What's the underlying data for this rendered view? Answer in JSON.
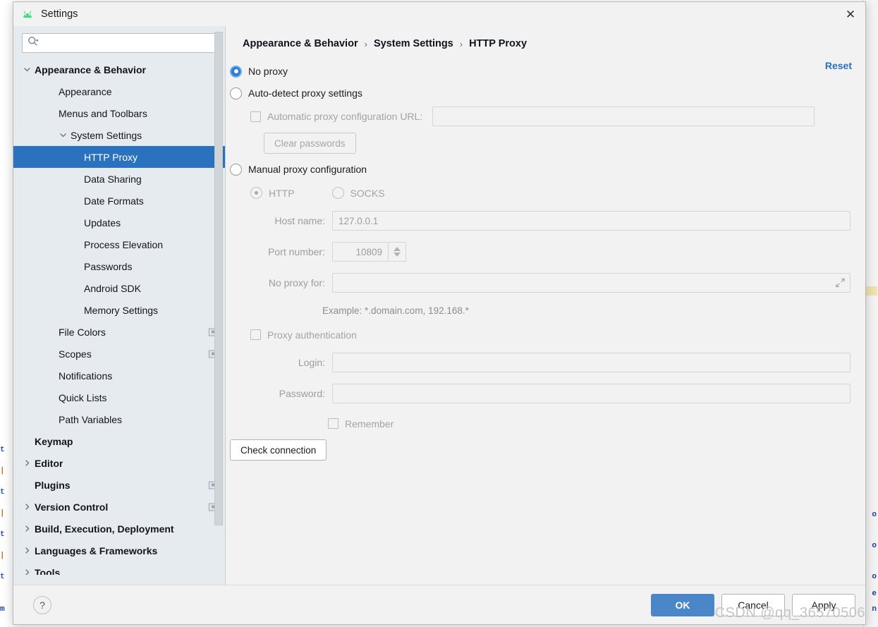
{
  "window": {
    "title": "Settings",
    "logo_icon": "android-logo-icon",
    "close_icon": "close-icon"
  },
  "sidebar": {
    "search": {
      "value": "",
      "placeholder": "",
      "icon": "search-icon"
    },
    "items": [
      {
        "label": "Appearance & Behavior",
        "level": 0,
        "bold": true,
        "arrow": "down",
        "selected": false,
        "badge": false
      },
      {
        "label": "Appearance",
        "level": 1,
        "bold": false,
        "arrow": "none",
        "selected": false,
        "badge": false
      },
      {
        "label": "Menus and Toolbars",
        "level": 1,
        "bold": false,
        "arrow": "none",
        "selected": false,
        "badge": false
      },
      {
        "label": "System Settings",
        "level": 2,
        "bold": false,
        "arrow": "down",
        "selected": false,
        "badge": false
      },
      {
        "label": "HTTP Proxy",
        "level": 3,
        "bold": false,
        "arrow": "none",
        "selected": true,
        "badge": false
      },
      {
        "label": "Data Sharing",
        "level": 3,
        "bold": false,
        "arrow": "none",
        "selected": false,
        "badge": false
      },
      {
        "label": "Date Formats",
        "level": 3,
        "bold": false,
        "arrow": "none",
        "selected": false,
        "badge": false
      },
      {
        "label": "Updates",
        "level": 3,
        "bold": false,
        "arrow": "none",
        "selected": false,
        "badge": false
      },
      {
        "label": "Process Elevation",
        "level": 3,
        "bold": false,
        "arrow": "none",
        "selected": false,
        "badge": false
      },
      {
        "label": "Passwords",
        "level": 3,
        "bold": false,
        "arrow": "none",
        "selected": false,
        "badge": false
      },
      {
        "label": "Android SDK",
        "level": 3,
        "bold": false,
        "arrow": "none",
        "selected": false,
        "badge": false
      },
      {
        "label": "Memory Settings",
        "level": 3,
        "bold": false,
        "arrow": "none",
        "selected": false,
        "badge": false
      },
      {
        "label": "File Colors",
        "level": 1,
        "bold": false,
        "arrow": "none",
        "selected": false,
        "badge": true
      },
      {
        "label": "Scopes",
        "level": 1,
        "bold": false,
        "arrow": "none",
        "selected": false,
        "badge": true
      },
      {
        "label": "Notifications",
        "level": 1,
        "bold": false,
        "arrow": "none",
        "selected": false,
        "badge": false
      },
      {
        "label": "Quick Lists",
        "level": 1,
        "bold": false,
        "arrow": "none",
        "selected": false,
        "badge": false
      },
      {
        "label": "Path Variables",
        "level": 1,
        "bold": false,
        "arrow": "none",
        "selected": false,
        "badge": false
      },
      {
        "label": "Keymap",
        "level": 0,
        "bold": true,
        "arrow": "none",
        "selected": false,
        "badge": false
      },
      {
        "label": "Editor",
        "level": 0,
        "bold": true,
        "arrow": "right",
        "selected": false,
        "badge": false
      },
      {
        "label": "Plugins",
        "level": 0,
        "bold": true,
        "arrow": "none",
        "selected": false,
        "badge": true
      },
      {
        "label": "Version Control",
        "level": 0,
        "bold": true,
        "arrow": "right",
        "selected": false,
        "badge": true
      },
      {
        "label": "Build, Execution, Deployment",
        "level": 0,
        "bold": true,
        "arrow": "right",
        "selected": false,
        "badge": false
      },
      {
        "label": "Languages & Frameworks",
        "level": 0,
        "bold": true,
        "arrow": "right",
        "selected": false,
        "badge": false
      },
      {
        "label": "Tools",
        "level": 0,
        "bold": true,
        "arrow": "right",
        "selected": false,
        "badge": false
      }
    ]
  },
  "main": {
    "breadcrumb": [
      "Appearance & Behavior",
      "System Settings",
      "HTTP Proxy"
    ],
    "breadcrumb_separator": "›",
    "reset_label": "Reset",
    "no_proxy": {
      "label": "No proxy",
      "checked": true
    },
    "auto_detect": {
      "label": "Auto-detect proxy settings",
      "checked": false
    },
    "auto_config_url": {
      "label": "Automatic proxy configuration URL:",
      "checked": false,
      "value": "",
      "disabled": true
    },
    "clear_passwords_label": "Clear passwords",
    "manual_proxy": {
      "label": "Manual proxy configuration",
      "checked": false
    },
    "protocol": {
      "http": {
        "label": "HTTP",
        "checked": true
      },
      "socks": {
        "label": "SOCKS",
        "checked": false
      }
    },
    "host_name": {
      "label": "Host name:",
      "value": "127.0.0.1"
    },
    "port_number": {
      "label": "Port number:",
      "value": "10809"
    },
    "no_proxy_for": {
      "label": "No proxy for:",
      "value": "",
      "expand_icon": "expand-icon"
    },
    "example_hint": "Example: *.domain.com, 192.168.*",
    "proxy_auth": {
      "label": "Proxy authentication",
      "checked": false
    },
    "login": {
      "label": "Login:",
      "value": ""
    },
    "password": {
      "label": "Password:",
      "value": ""
    },
    "remember": {
      "label": "Remember",
      "checked": false
    },
    "check_connection_label": "Check connection"
  },
  "footer": {
    "help_label": "?",
    "ok_label": "OK",
    "cancel_label": "Cancel",
    "apply_label": "Apply"
  },
  "watermark": "CSDN @qq_36570506",
  "colors": {
    "accent_blue": "#2a72bd",
    "primary_button": "#4a86c8",
    "link_blue": "#2a6fc4",
    "sidebar_bg": "#e6ebf0",
    "panel_bg": "#f2f2f2",
    "android_green": "#3ddc84"
  }
}
